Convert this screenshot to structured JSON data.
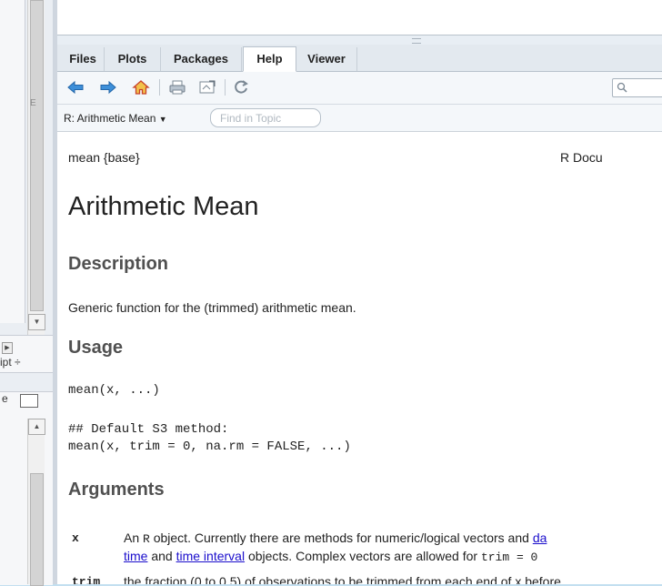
{
  "tabs": [
    {
      "label": "Files",
      "active": false
    },
    {
      "label": "Plots",
      "active": false
    },
    {
      "label": "Packages",
      "active": false
    },
    {
      "label": "Help",
      "active": true
    },
    {
      "label": "Viewer",
      "active": false
    }
  ],
  "toolbar": {
    "icons": [
      "back-arrow-icon",
      "forward-arrow-icon",
      "home-icon",
      "print-icon",
      "browser-icon",
      "refresh-icon",
      "search-icon"
    ]
  },
  "subbar": {
    "topic_label": "R: Arithmetic Mean",
    "find_placeholder": "Find in Topic"
  },
  "left_panel": {
    "script_label": "ipt",
    "edge_label": "E"
  },
  "doc": {
    "header_left": "mean {base}",
    "header_right": "R Docu",
    "title": "Arithmetic Mean",
    "description_heading": "Description",
    "description_text": "Generic function for the (trimmed) arithmetic mean.",
    "usage_heading": "Usage",
    "usage_line1": "mean(x, ...)",
    "usage_comment": "## Default S3 method:",
    "usage_line2": "mean(x, trim = 0, na.rm = FALSE, ...)",
    "arguments_heading": "Arguments",
    "arg_x_name": "x",
    "arg_x_text1_a": "An ",
    "arg_x_text1_r": "R",
    "arg_x_text1_b": " object. Currently there are methods for numeric/logical vectors and ",
    "arg_x_link1": "da",
    "arg_x_link2": "time",
    "arg_x_text2_a": " and ",
    "arg_x_link3": "time interval",
    "arg_x_text2_b": " objects. Complex vectors are allowed for ",
    "arg_x_code": "trim = 0",
    "arg_trim_name": "trim",
    "arg_trim_text": "the fraction (0 to 0.5) of observations to be trimmed from each end of x before"
  },
  "colors": {
    "link": "#1a0dcc",
    "heading": "#505050",
    "window_bg": "#c3dff0"
  }
}
